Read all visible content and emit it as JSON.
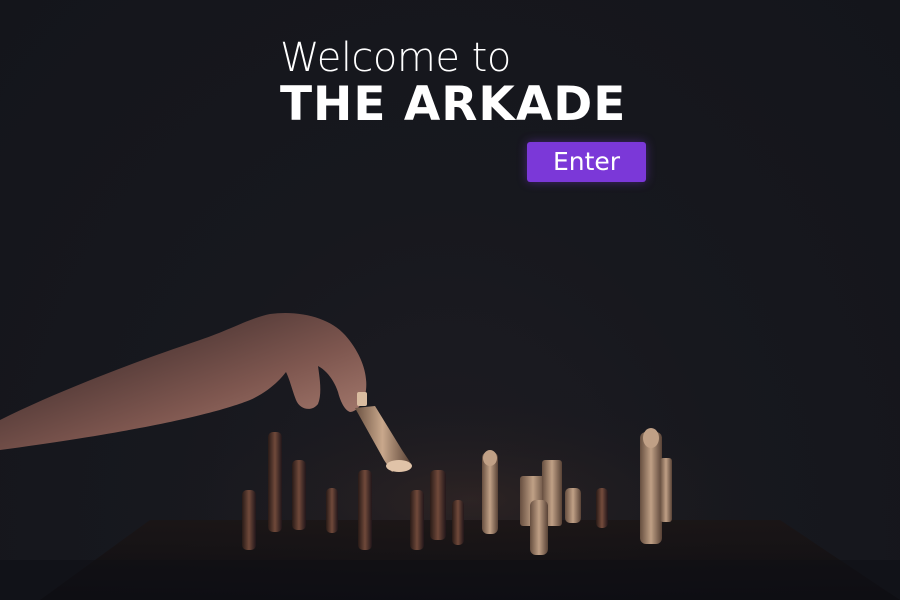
{
  "hero": {
    "welcome_text": "Welcome to",
    "brand_name": "THE ARKADE",
    "enter_label": "Enter"
  },
  "colors": {
    "background": "#16171d",
    "accent": "#7b38d8",
    "text": "#ffffff"
  },
  "background_image": {
    "subject": "hand-moving-chess-piece"
  }
}
